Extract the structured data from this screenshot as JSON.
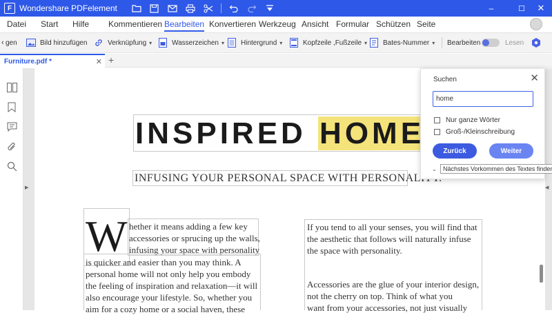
{
  "window": {
    "app_title": "Wondershare PDFelement",
    "logo_letter": "F",
    "title_icons": [
      "folder-icon",
      "save-icon",
      "mail-icon",
      "print-icon",
      "scissors-icon",
      "undo-icon",
      "redo-icon",
      "dropdown-icon"
    ],
    "controls": {
      "minimize": "–",
      "maximize": "☐",
      "close": "✕"
    },
    "bar_color": "#2e58e8"
  },
  "menu": {
    "items": [
      "Datei",
      "Start",
      "Hilfe",
      "Kommentieren",
      "Bearbeiten",
      "Konvertieren",
      "Werkzeug",
      "Ansicht",
      "Formular",
      "Schützen",
      "Seite"
    ],
    "active": "Bearbeiten"
  },
  "toolbar": {
    "scroll_left": "‹",
    "partial_label": "gen",
    "image_label": "Bild hinzufügen",
    "link_label": "Verknüpfung",
    "watermark_label": "Wasserzeichen",
    "background_label": "Hintergrund",
    "header_footer_label": "Kopfzeile ,Fußzeile",
    "bates_label": "Bates-Nummer",
    "edit_label": "Bearbeiten",
    "read_label": "Lesen",
    "caret": "▾"
  },
  "tabs": {
    "file_name": "Furniture.pdf *",
    "close": "✕",
    "add": "+"
  },
  "document": {
    "headline_before": "INSPIRED ",
    "headline_match": "HOME",
    "subheading": "INFUSING YOUR PERSONAL SPACE WITH PERSONALITY.",
    "drop_cap": "W",
    "col1_lines_right": [
      "hether it means adding a few key",
      "accessories or sprucing up the walls,",
      "infusing your space with personality"
    ],
    "col1_lines_full": [
      "is quicker and easier than you may think. A",
      "personal home will not only help you embody",
      "the feeling of inspiration and relaxation—it will",
      "also encourage your lifestyle. So, whether you",
      "aim for a cozy home or a social haven, these"
    ],
    "col2_para1": [
      "If you tend to all your senses, you will find that",
      "the aesthetic that follows will naturally infuse",
      "the space with personality."
    ],
    "col2_para2": [
      "Accessories are the glue of your interior design,",
      "not the cherry on top. Think of what you",
      "want from your accessories, not just visually"
    ]
  },
  "search": {
    "title": "Suchen",
    "close": "✕",
    "query": "home",
    "whole_words": "Nur ganze Wörter",
    "match_case": "Groß-/Kleinschreibung",
    "prev_button": "Zurück",
    "next_button": "Weiter",
    "tooltip": "Nächstes Vorkommen des Textes finden.",
    "prev_color": "#3d5be0",
    "next_color": "#6a84f2"
  },
  "colors": {
    "accent": "#2e58e8",
    "highlight": "#f4e37a"
  }
}
